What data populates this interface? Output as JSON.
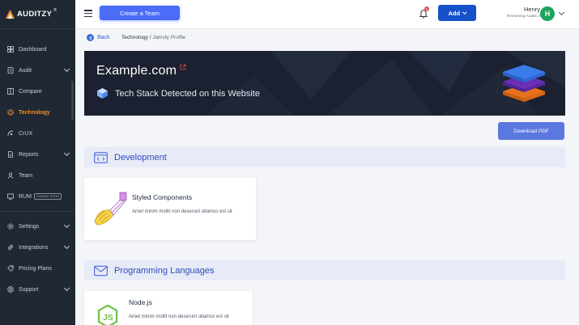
{
  "app": {
    "name": "AUDITZY",
    "trademark": "®"
  },
  "sidebar": {
    "items": [
      {
        "label": "Dashboard",
        "icon": "dashboard-icon",
        "has_chevron": false,
        "active": false
      },
      {
        "label": "Audit",
        "icon": "audit-icon",
        "has_chevron": true,
        "active": false
      },
      {
        "label": "Compare",
        "icon": "compare-icon",
        "has_chevron": false,
        "active": false
      },
      {
        "label": "Technology",
        "icon": "technology-icon",
        "has_chevron": false,
        "active": true
      },
      {
        "label": "CrUX",
        "icon": "crux-icon",
        "has_chevron": false,
        "active": false
      },
      {
        "label": "Reports",
        "icon": "reports-icon",
        "has_chevron": true,
        "active": false
      },
      {
        "label": "Team",
        "icon": "team-icon",
        "has_chevron": false,
        "active": false
      },
      {
        "label": "RUM",
        "icon": "rum-icon",
        "has_chevron": false,
        "active": false,
        "badge": "COMING SOON"
      },
      {
        "label": "Settings",
        "icon": "settings-icon",
        "has_chevron": true,
        "active": false
      },
      {
        "label": "Integrations",
        "icon": "integrations-icon",
        "has_chevron": true,
        "active": false
      },
      {
        "label": "Pricing Plans",
        "icon": "pricing-icon",
        "has_chevron": false,
        "active": false
      },
      {
        "label": "Support",
        "icon": "support-icon",
        "has_chevron": true,
        "active": false
      }
    ]
  },
  "topbar": {
    "create_team_label": "Create a Team",
    "notification_count": "0",
    "add_label": "Add",
    "user_name": "Henry",
    "user_subtext": "Remaining Audits 3",
    "avatar_initial": "H"
  },
  "breadcrumb": {
    "back_label": "Back",
    "path_main": "Technology",
    "path_sep": " / ",
    "path_sub": "Jamsfy Profile"
  },
  "hero": {
    "site": "Example.com",
    "subtitle": "Tech Stack Detected on this Website"
  },
  "actions": {
    "download_pdf_label": "Download PDF"
  },
  "sections": [
    {
      "title": "Development",
      "icon": "code-window-icon",
      "cards": [
        {
          "title": "Styled Components",
          "description": "Amet minim mollit non deserunt ullamco est sit",
          "icon": "styled-components-icon"
        }
      ]
    },
    {
      "title": "Programming Languages",
      "icon": "envelope-icon",
      "cards": [
        {
          "title": "Node.js",
          "description": "Amet minim mollit non deserunt ullamco est sit",
          "icon": "nodejs-icon"
        }
      ]
    }
  ],
  "colors": {
    "sidebar_bg": "#1f2833",
    "active_nav": "#f28c28",
    "primary": "#4a6cf7",
    "add_button": "#1552c9",
    "section_title": "#2e4ab8",
    "avatar": "#1ea35a"
  }
}
